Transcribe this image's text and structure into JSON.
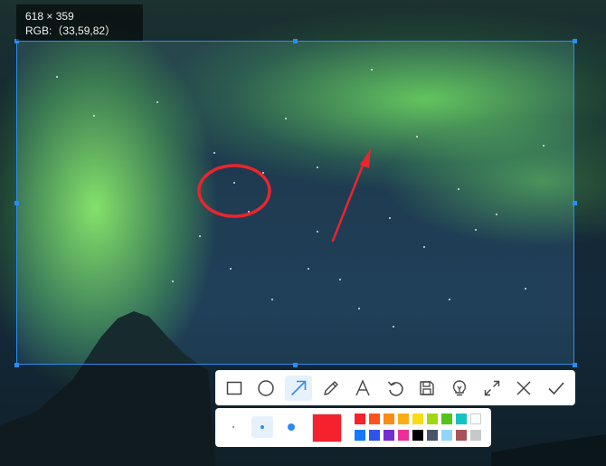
{
  "size_info": {
    "dimensions": "618 × 359",
    "rgb": "RGB:（33,59,82）"
  },
  "colors": {
    "accent": "#2b8cf0",
    "annotation": "#e8262c",
    "current": "#f5222d"
  },
  "toolbar": {
    "tools": [
      {
        "name": "rectangle-tool",
        "icon": "rectangle-icon",
        "active": false
      },
      {
        "name": "ellipse-tool",
        "icon": "circle-icon",
        "active": false
      },
      {
        "name": "arrow-tool",
        "icon": "arrow-icon",
        "active": true
      },
      {
        "name": "pencil-tool",
        "icon": "pencil-icon",
        "active": false
      },
      {
        "name": "text-tool",
        "icon": "text-icon",
        "active": false
      },
      {
        "name": "undo-button",
        "icon": "undo-icon",
        "active": false
      },
      {
        "name": "save-button",
        "icon": "save-icon",
        "active": false
      },
      {
        "name": "pin-button",
        "icon": "lightbulb-icon",
        "active": false
      },
      {
        "name": "fullscreen-button",
        "icon": "expand-icon",
        "active": false
      },
      {
        "name": "cancel-button",
        "icon": "close-icon",
        "active": false
      },
      {
        "name": "confirm-button",
        "icon": "check-icon",
        "active": false
      }
    ]
  },
  "stroke_sizes": [
    {
      "name": "stroke-small",
      "active": false
    },
    {
      "name": "stroke-medium",
      "active": true
    },
    {
      "name": "stroke-large",
      "active": false
    }
  ],
  "palette": {
    "row1": [
      "#f5222d",
      "#fa541c",
      "#fa8c16",
      "#faad14",
      "#fadb14",
      "#a0d911",
      "#52c41a",
      "#13c2c2",
      "#ffffff"
    ],
    "row2": [
      "#1677ff",
      "#2f54eb",
      "#722ed1",
      "#eb2f96",
      "#000000",
      "#4a5568",
      "#91d5ff",
      "#a8525a",
      "#c8c8c8"
    ]
  }
}
